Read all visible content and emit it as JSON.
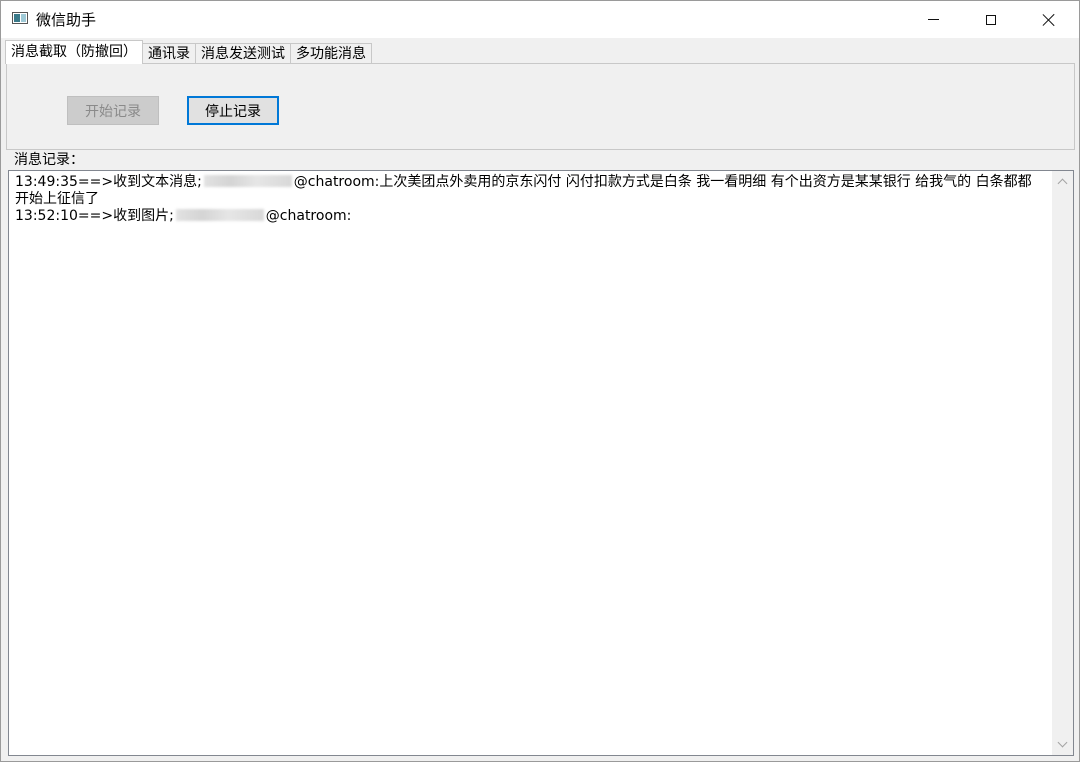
{
  "window": {
    "title": "微信助手",
    "icon": "app-window-icon",
    "controls": [
      "minimize-icon",
      "maximize-icon",
      "close-icon"
    ]
  },
  "tabs": [
    {
      "label": "消息截取（防撤回）",
      "active": true
    },
    {
      "label": "通讯录",
      "active": false
    },
    {
      "label": "消息发送测试",
      "active": false
    },
    {
      "label": "多功能消息",
      "active": false
    }
  ],
  "toolbar": {
    "start_label": "开始记录",
    "start_enabled": false,
    "stop_label": "停止记录"
  },
  "log": {
    "label": "消息记录：",
    "entries": [
      {
        "prefix": "13:49:35==>收到文本消息;",
        "sender_redacted": "13631961273",
        "suffix": "@chatroom:上次美团点外卖用的京东闪付 闪付扣款方式是白条 我一看明细 有个出资方是某某银行 给我气的 白条都都开始上征信了"
      },
      {
        "prefix": "13:52:10==>收到图片;",
        "sender_redacted": "13631961273",
        "suffix": "@chatroom:"
      }
    ]
  },
  "colors": {
    "focus_border": "#0078d7",
    "disabled_button": "#cccccc"
  }
}
